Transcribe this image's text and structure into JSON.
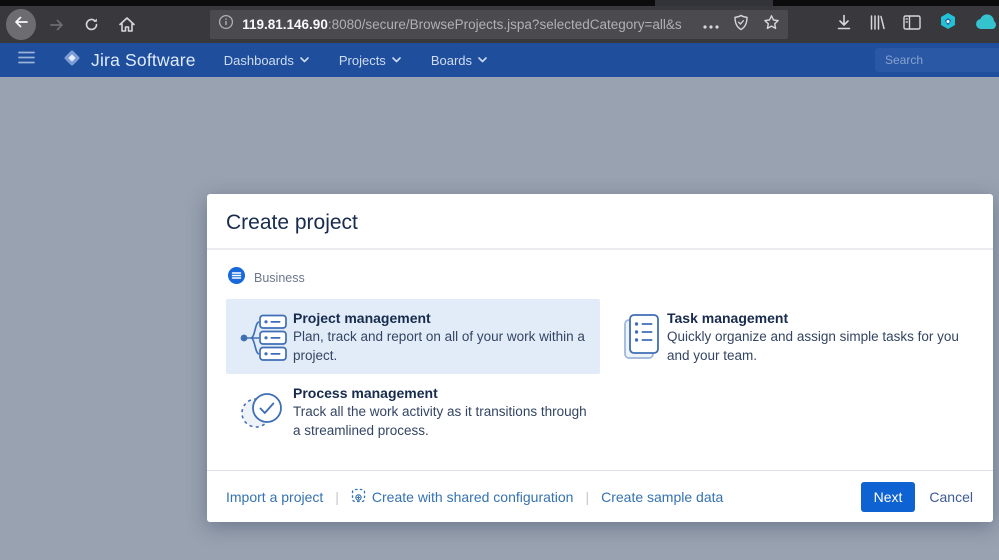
{
  "browser": {
    "url_host": "119.81.146.90",
    "url_rest": ":8080/secure/BrowseProjects.jspa?selectedCategory=all&s",
    "icons": [
      "back-icon",
      "forward-icon",
      "reload-icon",
      "home-icon",
      "info-icon",
      "overflow-dots-icon",
      "shield-icon",
      "star-icon",
      "download-icon",
      "library-icon",
      "sidebar-icon",
      "extension-hexagon-icon",
      "cloud-icon"
    ]
  },
  "navbar": {
    "logo_text": "Jira Software",
    "items": {
      "0": {
        "label": "Dashboards"
      },
      "1": {
        "label": "Projects"
      },
      "2": {
        "label": "Boards"
      }
    },
    "search_placeholder": "Search"
  },
  "modal": {
    "title": "Create project",
    "category": {
      "label": "Business",
      "icon": "business-circle-list-icon"
    },
    "options": {
      "0": {
        "title": "Project management",
        "description": "Plan, track and report on all of your work within a project.",
        "selected": true,
        "icon": "hierarchy-icon"
      },
      "1": {
        "title": "Task management",
        "description": "Quickly organize and assign simple tasks for you and your team.",
        "selected": false,
        "icon": "task-list-icon"
      },
      "2": {
        "title": "Process management",
        "description": "Track all the work activity as it transitions through a streamlined process.",
        "selected": false,
        "icon": "process-check-icon"
      }
    },
    "footer": {
      "links": {
        "0": {
          "label": "Import a project"
        },
        "1": {
          "label": "Create with shared configuration",
          "icon": "shared-config-icon"
        },
        "2": {
          "label": "Create sample data"
        }
      },
      "separator": "|",
      "next_label": "Next",
      "cancel_label": "Cancel"
    }
  },
  "colors": {
    "navbar_bg": "#1e4e9c",
    "toolbar_bg": "#38383d",
    "urlbar_bg": "#4a4a4f",
    "page_bg": "#99a2b0",
    "selected_tile_bg": "#e2ecf9",
    "link_blue": "#3572b0",
    "primary_button_bg": "#0f62d2",
    "title_text": "#172b4d",
    "extension_teal": "#24c1d5"
  }
}
